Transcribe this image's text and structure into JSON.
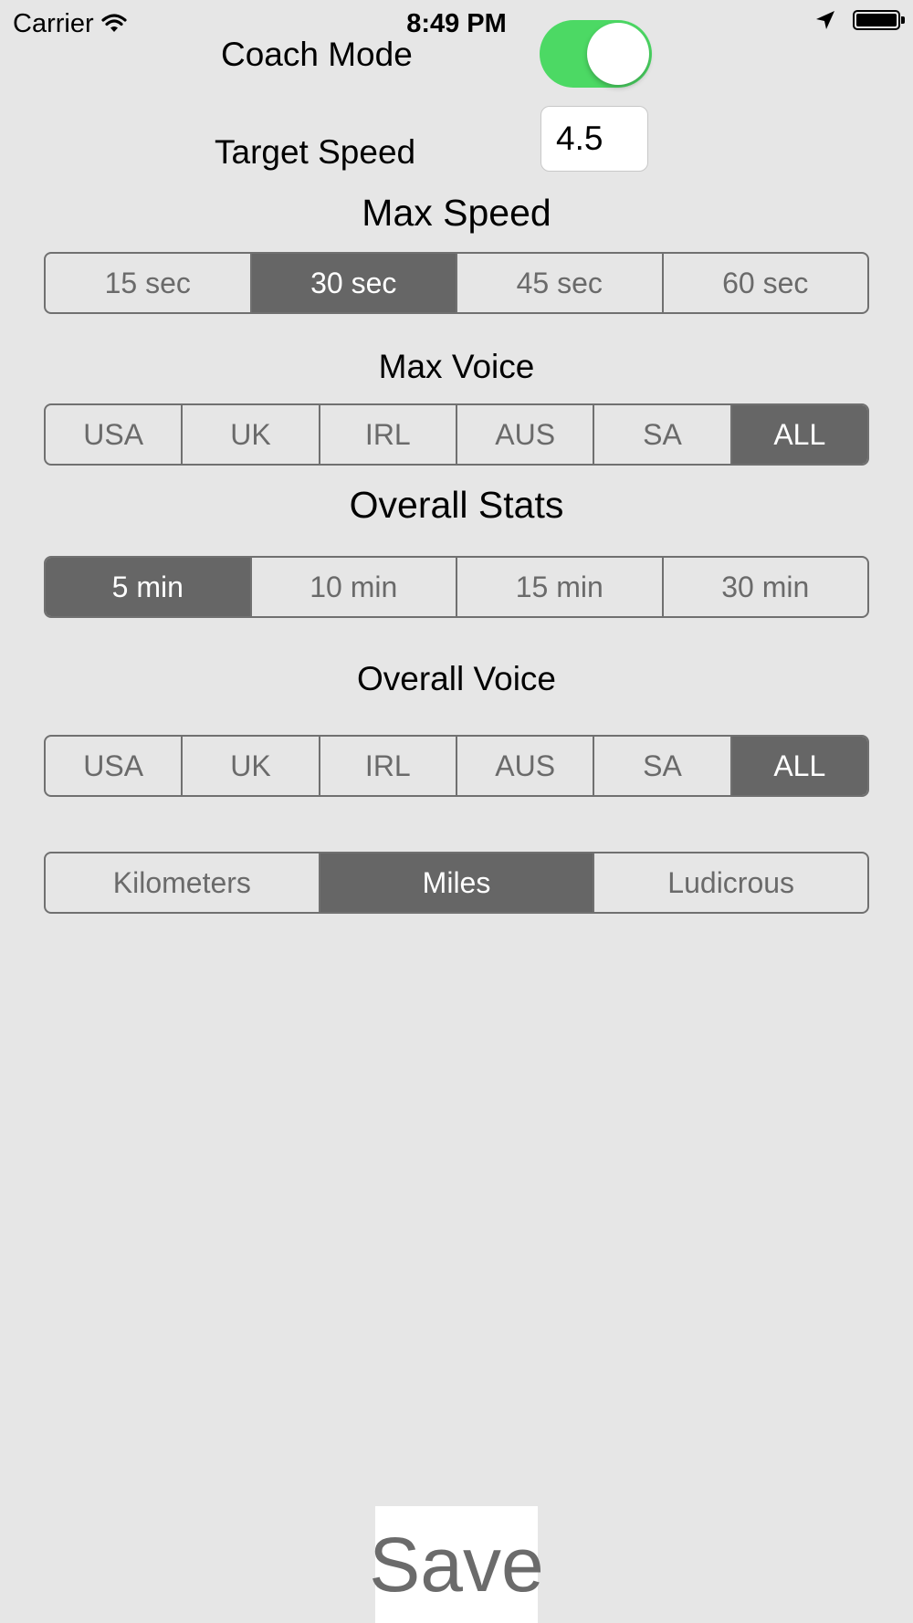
{
  "status_bar": {
    "carrier": "Carrier",
    "time": "8:49 PM"
  },
  "coach_mode": {
    "label": "Coach Mode",
    "enabled": true,
    "on_color": "#4cd964"
  },
  "target_speed": {
    "label": "Target Speed",
    "value": "4.5"
  },
  "max_speed": {
    "heading": "Max Speed",
    "options": [
      "15 sec",
      "30 sec",
      "45 sec",
      "60 sec"
    ],
    "selected": "30 sec"
  },
  "max_voice": {
    "heading": "Max Voice",
    "options": [
      "USA",
      "UK",
      "IRL",
      "AUS",
      "SA",
      "ALL"
    ],
    "selected": "ALL"
  },
  "overall_stats": {
    "heading": "Overall Stats",
    "options": [
      "5 min",
      "10 min",
      "15 min",
      "30 min"
    ],
    "selected": "5 min"
  },
  "overall_voice": {
    "heading": "Overall Voice",
    "options": [
      "USA",
      "UK",
      "IRL",
      "AUS",
      "SA",
      "ALL"
    ],
    "selected": "ALL"
  },
  "units": {
    "options": [
      "Kilometers",
      "Miles",
      "Ludicrous"
    ],
    "selected": "Miles"
  },
  "save_button": {
    "label": "Save"
  },
  "colors": {
    "background": "#e6e6e6",
    "selected_segment": "#666666",
    "segment_border": "#707070",
    "toggle_on": "#4cd964"
  },
  "icons": [
    "wifi-icon",
    "location-arrow-icon",
    "battery-icon"
  ]
}
